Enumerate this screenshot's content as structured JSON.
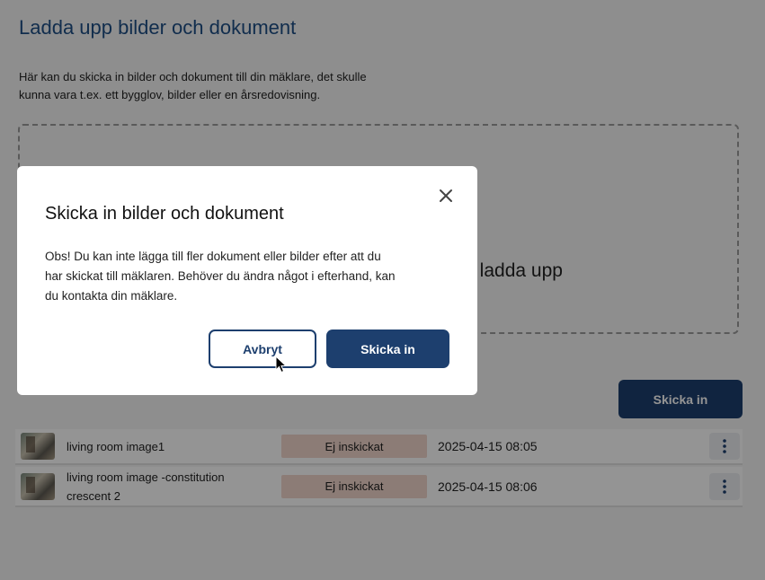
{
  "page": {
    "title": "Ladda upp bilder och dokument",
    "intro_line1": "Här kan du skicka in bilder och dokument till din mäklare, det skulle",
    "intro_line2": "kunna vara t.ex. ett bygglov, bilder eller en årsredovisning.",
    "dropzone_text": "t ladda upp",
    "submit_label": "Skicka in"
  },
  "files": [
    {
      "name": "living room image1",
      "status": "Ej inskickat",
      "date": "2025-04-15 08:05",
      "thumb_icon": "photo-thumbnail",
      "menu_icon": "kebab-menu-icon"
    },
    {
      "name": "living room image -constitution crescent 2",
      "status": "Ej inskickat",
      "date": "2025-04-15 08:06",
      "thumb_icon": "photo-thumbnail",
      "menu_icon": "kebab-menu-icon"
    }
  ],
  "modal": {
    "title": "Skicka in bilder och dokument",
    "body_line1": "Obs! Du kan inte lägga till fler dokument eller bilder efter att du",
    "body_line2": "har skickat till mäklaren. Behöver du ändra något i efterhand, kan",
    "body_line3": "du kontakta din mäklare.",
    "cancel_label": "Avbryt",
    "confirm_label": "Skicka in",
    "close_icon": "close-icon"
  },
  "colors": {
    "primary": "#1d3f6e",
    "title": "#1e4f86",
    "status_badge": "#f2d6cb"
  }
}
